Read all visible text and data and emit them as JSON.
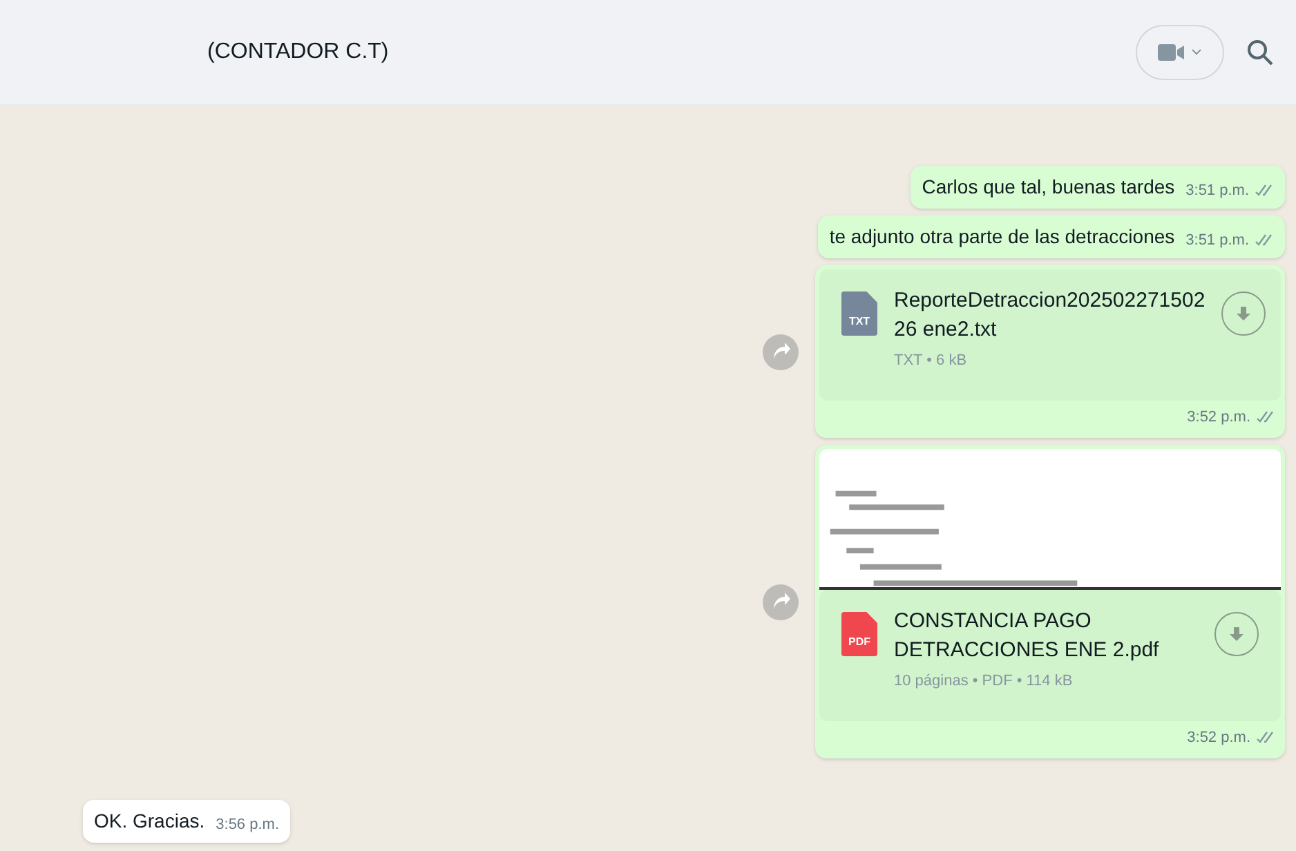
{
  "header": {
    "title": "(CONTADOR C.T)"
  },
  "messages": [
    {
      "kind": "text",
      "outgoing": true,
      "text": "Carlos que tal, buenas tardes",
      "time": "3:51 p.m."
    },
    {
      "kind": "text",
      "outgoing": true,
      "text": "te adjunto otra parte de las detracciones",
      "time": "3:51 p.m."
    },
    {
      "kind": "document",
      "outgoing": true,
      "file_type": "TXT",
      "file_name": "ReporteDetraccion202502271502\n26 ene2.txt",
      "details": "TXT • 6 kB",
      "time": "3:52 p.m.",
      "preview": false
    },
    {
      "kind": "document",
      "outgoing": true,
      "file_type": "PDF",
      "file_name": "CONSTANCIA PAGO\nDETRACCIONES ENE 2.pdf",
      "details": "10 páginas • PDF • 114 kB",
      "time": "3:52 p.m.",
      "preview": true
    },
    {
      "kind": "text",
      "outgoing": false,
      "text": "OK. Gracias.",
      "time": "3:56 p.m."
    }
  ]
}
